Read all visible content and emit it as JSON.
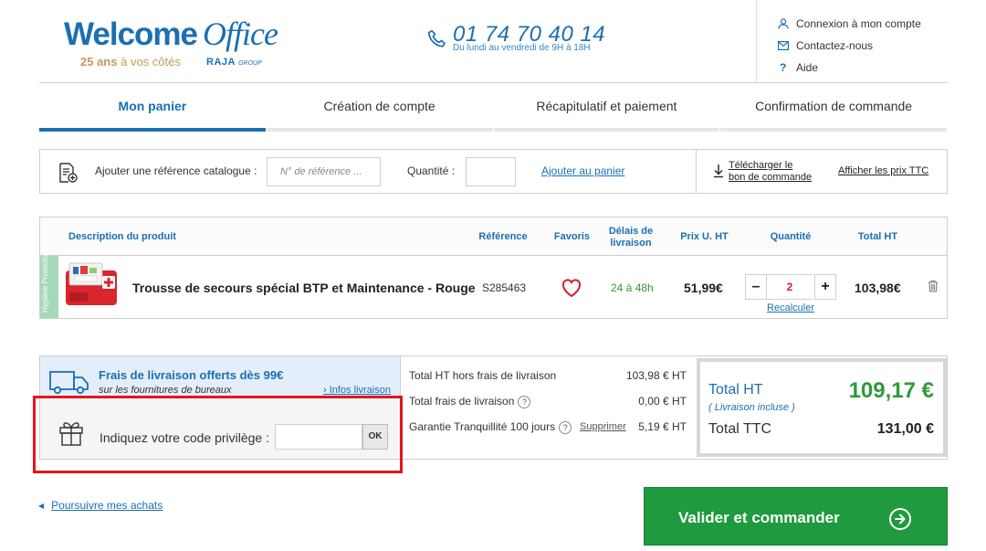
{
  "header": {
    "logo_word1": "Welcome",
    "logo_word2": "Office",
    "tagline_bold": "25 ans",
    "tagline_rest": " à vos côtés",
    "raja": "RAJA",
    "raja_group": "GROUP",
    "phone": "01 74 70 40 14",
    "phone_hours": "Du lundi au vendredi de 9H à 18H",
    "links": [
      {
        "label": "Connexion à mon compte",
        "icon": "user-icon"
      },
      {
        "label": "Contactez-nous",
        "icon": "mail-icon"
      },
      {
        "label": "Aide",
        "icon": "question-icon"
      }
    ]
  },
  "steps": [
    {
      "label": "Mon panier",
      "active": true
    },
    {
      "label": "Création de compte",
      "active": false
    },
    {
      "label": "Récapitulatif et paiement",
      "active": false
    },
    {
      "label": "Confirmation de commande",
      "active": false
    }
  ],
  "refbar": {
    "add_label": "Ajouter une référence catalogue :",
    "ref_placeholder": "N° de référence ...",
    "qty_label": "Quantité :",
    "add_link": "Ajouter au panier",
    "download_line1": "Télécharger le",
    "download_line2": "bon de commande",
    "ttc_link": "Afficher les prix TTC"
  },
  "table": {
    "headers": {
      "description": "Description du produit",
      "reference": "Référence",
      "favoris": "Favoris",
      "delais_1": "Délais de",
      "delais_2": "livraison",
      "prix": "Prix U. HT",
      "quantite": "Quantité",
      "total": "Total HT"
    },
    "row": {
      "category": "Hygiène Protection",
      "name": "Trousse de secours spécial BTP et Maintenance - Rouge",
      "reference": "S285463",
      "delay": "24 à 48h",
      "unit_price": "51,99€",
      "quantity": "2",
      "recalc": "Recalculer",
      "total": "103,98€",
      "minus": "–",
      "plus": "+"
    }
  },
  "summary": {
    "promo_title": "Frais de livraison offerts dès 99€",
    "promo_sub": "sur les fournitures de bureaux",
    "promo_link": "› Infos livraison",
    "code_label": "Indiquez votre code privilège :",
    "ok": "OK",
    "costs": [
      {
        "label": "Total HT hors frais de livraison",
        "value": "103,98 € HT"
      },
      {
        "label": "Total frais de livraison",
        "value": "0,00 € HT"
      },
      {
        "label": "Garantie Tranquillité 100 jours",
        "value": "5,19 € HT",
        "action": "Supprimer"
      }
    ],
    "total_ht_label": "Total HT",
    "total_ht_sub": "( Livraison incluse )",
    "total_ht_value": "109,17 €",
    "total_ttc_label": "Total TTC",
    "total_ttc_value": "131,00 €"
  },
  "footer": {
    "continue": "Poursuivre mes achats",
    "validate": "Valider et commander"
  },
  "colors": {
    "brand_blue": "#1b6fb3",
    "green": "#1f9a3e",
    "highlight_red": "#e3161b"
  }
}
